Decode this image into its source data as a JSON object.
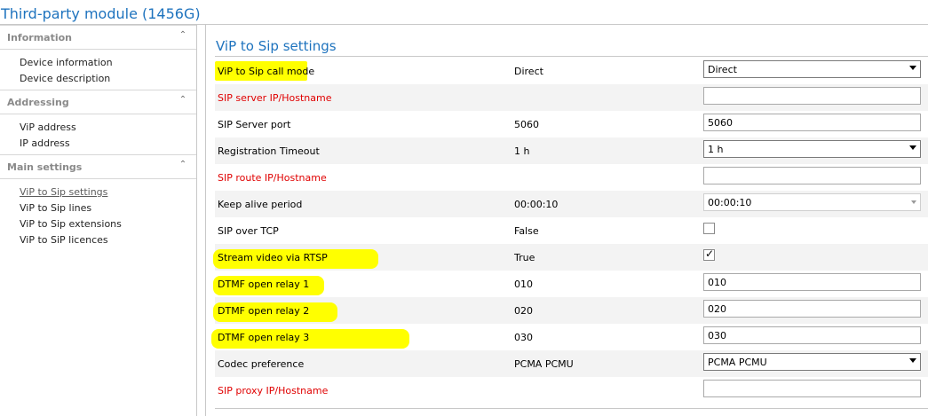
{
  "window": {
    "title": "Third-party module (1456G)"
  },
  "sidebar": {
    "sections": [
      {
        "label": "Information",
        "items": [
          "Device information",
          "Device description"
        ]
      },
      {
        "label": "Addressing",
        "items": [
          "ViP address",
          "IP address"
        ]
      },
      {
        "label": "Main settings",
        "items": [
          "ViP to Sip settings",
          "ViP to Sip lines",
          "ViP to Sip extensions",
          "ViP to SiP licences"
        ]
      }
    ],
    "active_item": "ViP to Sip settings"
  },
  "main": {
    "heading": "ViP to Sip settings",
    "rows": [
      {
        "label": "ViP to Sip call mode",
        "value": "Direct",
        "control": "select",
        "control_value": "Direct",
        "required": false,
        "highlight": true
      },
      {
        "label": "SIP server IP/Hostname",
        "value": "",
        "control": "text",
        "control_value": "",
        "required": true,
        "highlight": false
      },
      {
        "label": "SIP Server port",
        "value": "5060",
        "control": "text",
        "control_value": "5060",
        "required": false,
        "highlight": false
      },
      {
        "label": "Registration Timeout",
        "value": "1 h",
        "control": "select",
        "control_value": "1 h",
        "required": false,
        "highlight": false
      },
      {
        "label": "SIP route IP/Hostname",
        "value": "",
        "control": "text",
        "control_value": "",
        "required": true,
        "highlight": false
      },
      {
        "label": "Keep alive period",
        "value": "00:00:10",
        "control": "select-light",
        "control_value": "00:00:10",
        "required": false,
        "highlight": false
      },
      {
        "label": "SIP over TCP",
        "value": "False",
        "control": "checkbox",
        "checked": false,
        "required": false,
        "highlight": false
      },
      {
        "label": "Stream video via RTSP",
        "value": "True",
        "control": "checkbox",
        "checked": true,
        "required": false,
        "highlight": true
      },
      {
        "label": "DTMF open relay 1",
        "value": "010",
        "control": "text",
        "control_value": "010",
        "required": false,
        "highlight": true
      },
      {
        "label": "DTMF open relay 2",
        "value": "020",
        "control": "text",
        "control_value": "020",
        "required": false,
        "highlight": true
      },
      {
        "label": "DTMF open relay 3",
        "value": "030",
        "control": "text",
        "control_value": "030",
        "required": false,
        "highlight": true
      },
      {
        "label": "Codec preference",
        "value": "PCMA PCMU",
        "control": "select",
        "control_value": "PCMA PCMU",
        "required": false,
        "highlight": false
      },
      {
        "label": "SIP proxy IP/Hostname",
        "value": "",
        "control": "text",
        "control_value": "",
        "required": true,
        "highlight": false
      }
    ]
  },
  "colors": {
    "accent": "#1e73be",
    "required": "#e00000",
    "highlight": "#ffff00"
  }
}
